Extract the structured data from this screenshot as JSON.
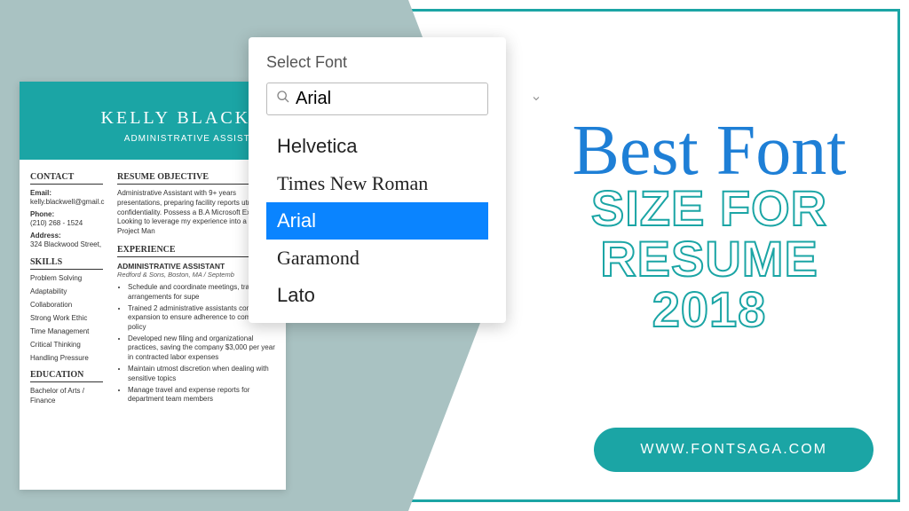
{
  "resume": {
    "name": "KELLY BLACKW",
    "subtitle": "ADMINISTRATIVE ASSISTANT",
    "left": {
      "contact_h": "CONTACT",
      "email_lbl": "Email:",
      "email_val": "kelly.blackwell@gmail.c",
      "phone_lbl": "Phone:",
      "phone_val": "(210) 268 - 1524",
      "address_lbl": "Address:",
      "address_val": "324 Blackwood Street,",
      "skills_h": "SKILLS",
      "skills": [
        "Problem Solving",
        "Adaptability",
        "Collaboration",
        "Strong Work Ethic",
        "Time Management",
        "Critical Thinking",
        "Handling Pressure"
      ],
      "edu_h": "EDUCATION",
      "edu_line": "Bachelor of Arts / Finance"
    },
    "right": {
      "obj_h": "RESUME OBJECTIVE",
      "obj_body": "Administrative Assistant with 9+ years presentations, preparing facility reports utmost confidentiality.  Possess a B.A Microsoft Excel. Looking to leverage my experience into a role as Project Man",
      "exp_h": "EXPERIENCE",
      "job_title": "ADMINISTRATIVE ASSISTANT",
      "job_meta": "Redford & Sons, Boston, MA /  Septemb",
      "bullets": [
        "Schedule and coordinate meetings, travel arrangements for supe",
        "Trained 2 administrative assistants company expansion to ensure adherence to company policy",
        "Developed new filing and organizational practices, saving the company $3,000 per year in contracted labor expenses",
        "Maintain utmost discretion when dealing with sensitive topics",
        "Manage travel and expense reports for department team members"
      ]
    }
  },
  "popup": {
    "title": "Select Font",
    "search_value": "Arial",
    "options": {
      "helvetica": "Helvetica",
      "tnr": "Times New Roman",
      "arial": "Arial",
      "garamond": "Garamond",
      "lato": "Lato"
    }
  },
  "headline": {
    "script": "Best Font",
    "line1": "SIZE FOR",
    "line2": "RESUME 2018"
  },
  "url": "WWW.FONTSAGA.COM"
}
